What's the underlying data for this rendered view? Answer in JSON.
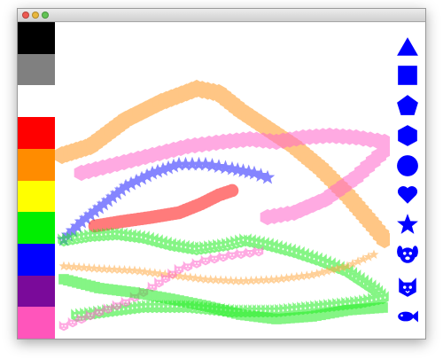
{
  "window": {
    "traffic_lights": [
      "close",
      "minimize",
      "maximize"
    ]
  },
  "palette": {
    "colors": [
      {
        "name": "black",
        "hex": "#000000"
      },
      {
        "name": "gray",
        "hex": "#808080"
      },
      {
        "name": "white",
        "hex": "#ffffff"
      },
      {
        "name": "red",
        "hex": "#ff0000"
      },
      {
        "name": "orange",
        "hex": "#ff8c00"
      },
      {
        "name": "yellow",
        "hex": "#ffff00"
      },
      {
        "name": "green",
        "hex": "#00ee00"
      },
      {
        "name": "blue",
        "hex": "#0000ff"
      },
      {
        "name": "purple",
        "hex": "#7a0a9a"
      },
      {
        "name": "pink",
        "hex": "#ff55bb"
      }
    ]
  },
  "shape_tools": {
    "icon_color": "#0000ff",
    "items": [
      "triangle-icon",
      "square-icon",
      "pentagon-icon",
      "hexagon-icon",
      "circle-icon",
      "heart-icon",
      "star-icon",
      "dog-icon",
      "cat-icon",
      "fish-icon"
    ]
  },
  "drawing": {
    "strokes": [
      {
        "name": "orange-hexagon-trail",
        "color": "#ff9922",
        "brush": "hexagon"
      },
      {
        "name": "pink-hexagon-trail",
        "color": "#ff66cc",
        "brush": "hexagon"
      },
      {
        "name": "blue-star-trail",
        "color": "#2222ff",
        "brush": "star"
      },
      {
        "name": "red-circle-trail",
        "color": "#ff1111",
        "brush": "circle"
      },
      {
        "name": "green-cat-trail",
        "color": "#22ee22",
        "brush": "cat"
      },
      {
        "name": "orange-star-trail",
        "color": "#ffaa44",
        "brush": "star"
      },
      {
        "name": "pink-cat-trail",
        "color": "#ff66cc",
        "brush": "cat"
      },
      {
        "name": "green-square-trail",
        "color": "#22ee22",
        "brush": "square"
      }
    ]
  }
}
